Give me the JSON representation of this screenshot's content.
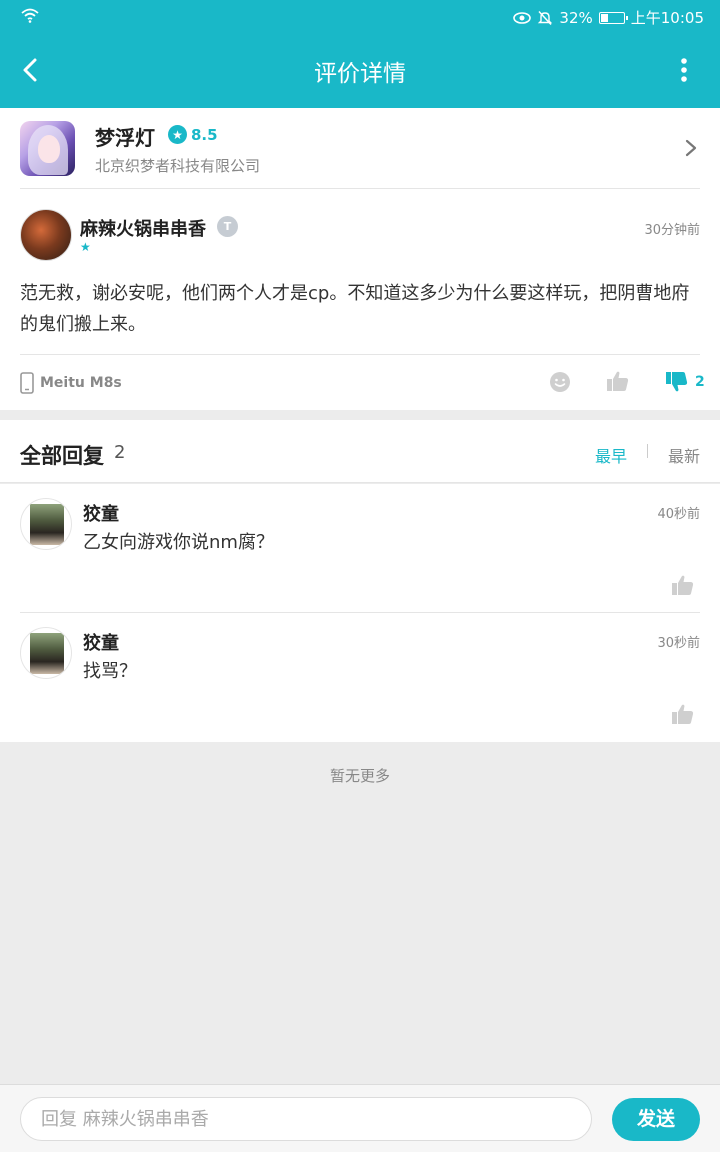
{
  "status_bar": {
    "battery": "32%",
    "battery_level": 0.32,
    "time": "上午10:05",
    "icons": [
      "wifi-icon",
      "eye-icon",
      "bell-off-icon",
      "battery-icon"
    ]
  },
  "app_bar": {
    "title": "评价详情",
    "icons": [
      "back-arrow-icon",
      "more-vertical-icon"
    ]
  },
  "game": {
    "name": "梦浮灯",
    "rating": "8.5",
    "developer": "北京织梦者科技有限公司"
  },
  "review": {
    "username": "麻辣火锅串串香",
    "level_badge": "T",
    "time": "30分钟前",
    "content": "范无救，谢必安呢，他们两个人才是cp。不知道这多少为什么要这样玩，把阴曹地府的鬼们搬上来。",
    "device": "Meitu M8s",
    "dislike_count": "2"
  },
  "replies": {
    "title": "全部回复",
    "count": "2",
    "sort_options": [
      "最早",
      "最新"
    ],
    "active_sort": "最早",
    "items": [
      {
        "name": "狡童",
        "time": "40秒前",
        "text": "乙女向游戏你说nm腐？"
      },
      {
        "name": "狡童",
        "time": "30秒前",
        "text": "找骂？"
      }
    ],
    "no_more": "暂无更多"
  },
  "composer": {
    "placeholder": "回复 麻辣火锅串串香",
    "send_label": "发送"
  },
  "colors": {
    "accent": "#19b8c8",
    "background": "#ececec"
  }
}
